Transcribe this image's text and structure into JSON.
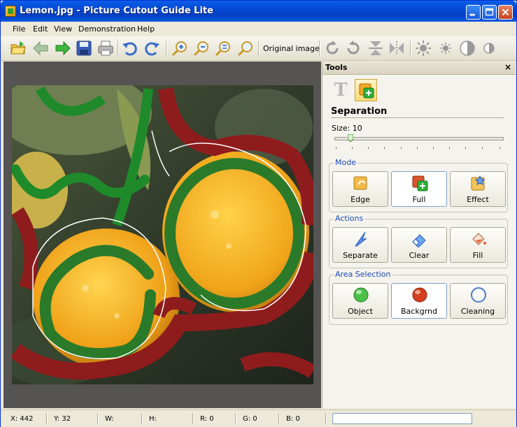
{
  "window": {
    "title": "Lemon.jpg - Picture Cutout Guide Lite"
  },
  "menu": {
    "items": [
      "File",
      "Edit",
      "View",
      "Demonstration",
      "Help"
    ]
  },
  "toolbar": {
    "original_image_label": "Original image",
    "buttons": [
      "open-icon",
      "back-icon",
      "forward-icon",
      "save-icon",
      "print-icon",
      "undo-icon",
      "redo-icon",
      "zoom-in-icon",
      "zoom-out-icon",
      "zoom-fit-icon",
      "zoom-actual-icon",
      "rotate-right-icon",
      "rotate-left-icon",
      "flip-vertical-icon",
      "flip-horizontal-icon",
      "brightness-icon",
      "brightness-small-icon",
      "contrast-icon",
      "contrast-small-icon"
    ]
  },
  "panel": {
    "title": "Tools",
    "close": "×",
    "section_title": "Separation",
    "size_label": "Size: 10",
    "size_value": 10,
    "mode": {
      "label": "Mode",
      "buttons": [
        {
          "label": "Edge",
          "icon": "edge-icon"
        },
        {
          "label": "Full",
          "icon": "full-icon",
          "active": true
        },
        {
          "label": "Effect",
          "icon": "effect-icon"
        }
      ]
    },
    "actions": {
      "label": "Actions",
      "buttons": [
        {
          "label": "Separate",
          "icon": "separate-icon"
        },
        {
          "label": "Clear",
          "icon": "eraser-icon"
        },
        {
          "label": "Fill",
          "icon": "fill-icon"
        }
      ]
    },
    "area_selection": {
      "label": "Area Selection",
      "buttons": [
        {
          "label": "Object",
          "icon": "object-icon"
        },
        {
          "label": "Backgrnd",
          "icon": "background-icon",
          "active": true
        },
        {
          "label": "Cleaning",
          "icon": "cleaning-icon"
        }
      ]
    }
  },
  "status": {
    "x": "X: 442",
    "y": "Y: 32",
    "w": "W:",
    "h": "H:",
    "r": "R: 0",
    "g": "G: 0",
    "b": "B: 0"
  },
  "colors": {
    "object_mark": "#1e8a2a",
    "background_mark": "#9a1c1c",
    "accent": "#1e4bb8"
  }
}
